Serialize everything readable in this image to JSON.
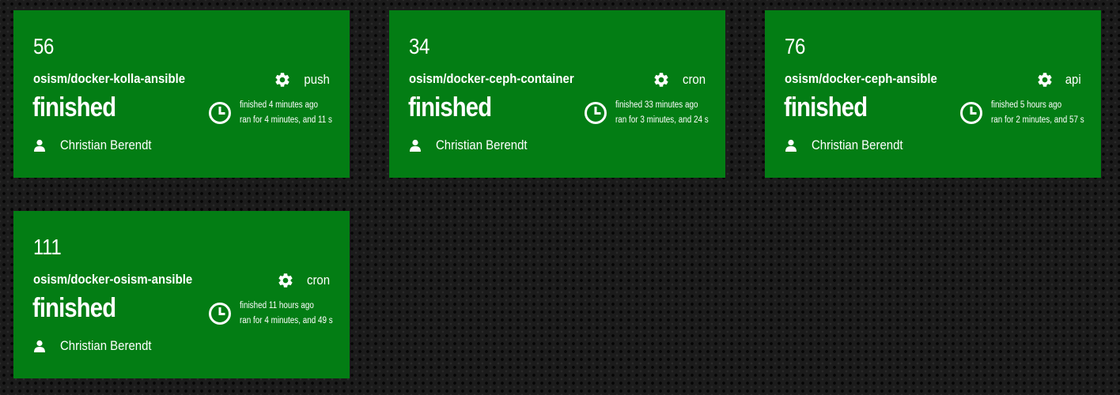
{
  "colors": {
    "card_background": "#037d14",
    "page_background": "#1b1b1b",
    "text": "#ffffff"
  },
  "builds": [
    {
      "number": "56",
      "repo": "osism/docker-kolla-ansible",
      "event": "push",
      "status": "finished",
      "finished_text": "finished 4 minutes ago",
      "duration_text": "ran for 4 minutes, and 11 s",
      "author": "Christian Berendt",
      "icons": {
        "event": "gear-icon",
        "time": "clock-icon",
        "author": "user-icon"
      }
    },
    {
      "number": "34",
      "repo": "osism/docker-ceph-container",
      "event": "cron",
      "status": "finished",
      "finished_text": "finished 33 minutes ago",
      "duration_text": "ran for 3 minutes, and 24 s",
      "author": "Christian Berendt",
      "icons": {
        "event": "gear-icon",
        "time": "clock-icon",
        "author": "user-icon"
      }
    },
    {
      "number": "76",
      "repo": "osism/docker-ceph-ansible",
      "event": "api",
      "status": "finished",
      "finished_text": "finished 5 hours ago",
      "duration_text": "ran for 2 minutes, and 57 s",
      "author": "Christian Berendt",
      "icons": {
        "event": "gear-icon",
        "time": "clock-icon",
        "author": "user-icon"
      }
    },
    {
      "number": "111",
      "repo": "osism/docker-osism-ansible",
      "event": "cron",
      "status": "finished",
      "finished_text": "finished 11 hours ago",
      "duration_text": "ran for 4 minutes, and 49 s",
      "author": "Christian Berendt",
      "icons": {
        "event": "gear-icon",
        "time": "clock-icon",
        "author": "user-icon"
      }
    }
  ]
}
